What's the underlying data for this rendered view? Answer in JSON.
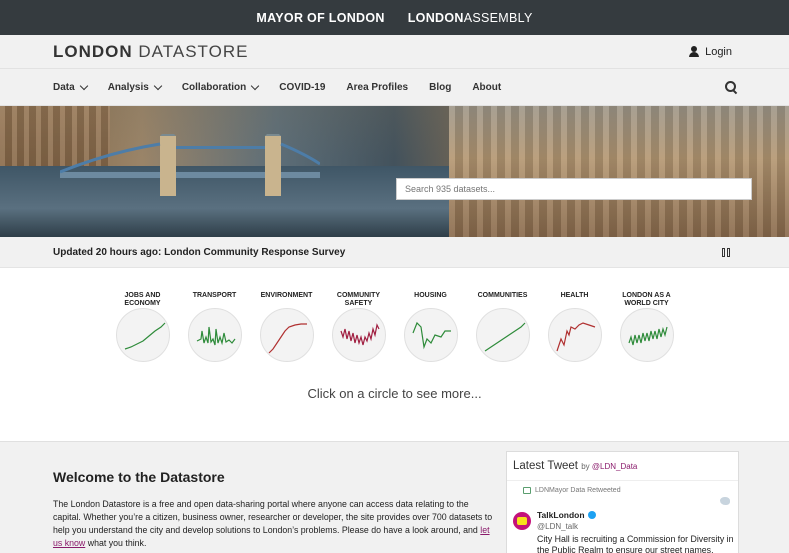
{
  "topbar": {
    "mayor_bold": "MAYOR OF LONDON",
    "assembly_bold": "LONDON",
    "assembly_light": "ASSEMBLY"
  },
  "header": {
    "logo_bold": "LONDON",
    "logo_light": " DATASTORE",
    "login_label": "Login",
    "login_icon": "person-icon"
  },
  "nav": {
    "items": [
      {
        "label": "Data",
        "dropdown": true
      },
      {
        "label": "Analysis",
        "dropdown": true
      },
      {
        "label": "Collaboration",
        "dropdown": true
      },
      {
        "label": "COVID-19",
        "dropdown": false
      },
      {
        "label": "Area Profiles",
        "dropdown": false
      },
      {
        "label": "Blog",
        "dropdown": false
      },
      {
        "label": "About",
        "dropdown": false
      }
    ],
    "search_icon": "search-icon"
  },
  "hero": {
    "search_placeholder": "Search 935 datasets..."
  },
  "updated": {
    "text": "Updated 20 hours ago: London Community Response Survey",
    "pause_icon": "pause-icon"
  },
  "circles": [
    {
      "label": "JOBS AND\nECONOMY",
      "color": "#2e8b3a"
    },
    {
      "label": "TRANSPORT",
      "color": "#2e8b3a"
    },
    {
      "label": "ENVIRONMENT",
      "color": "#b03030"
    },
    {
      "label": "COMMUNITY\nSAFETY",
      "color": "#a01e40"
    },
    {
      "label": "HOUSING",
      "color": "#2e8b3a"
    },
    {
      "label": "COMMUNITIES",
      "color": "#2e8b3a"
    },
    {
      "label": "HEALTH",
      "color": "#b03030"
    },
    {
      "label": "LONDON AS A\nWORLD CITY",
      "color": "#2e8b3a"
    }
  ],
  "click_hint": "Click on a circle to see more...",
  "welcome": {
    "title": "Welcome to the Datastore",
    "body_before": "The London Datastore is  a free and open data-sharing portal  where anyone can access data relating to the capital.  Whether you’re a citizen, business owner, researcher or developer, the site provides over 700 datasets to help you understand the city and develop solutions to London’s problems. Please do have a look around, and ",
    "link_text": "let us know",
    "body_after": " what you think."
  },
  "tweets": {
    "title": "Latest Tweet",
    "by": "by",
    "by_handle": "@LDN_Data",
    "retweet_text": "LDNMayor Data Retweeted",
    "name": "TalkLondon",
    "handle": "@LDN_talk",
    "text": "City Hall is recruiting a Commission for Diversity in the Public Realm to ensure our street names, squares, statues and monuments tell the full story of"
  }
}
